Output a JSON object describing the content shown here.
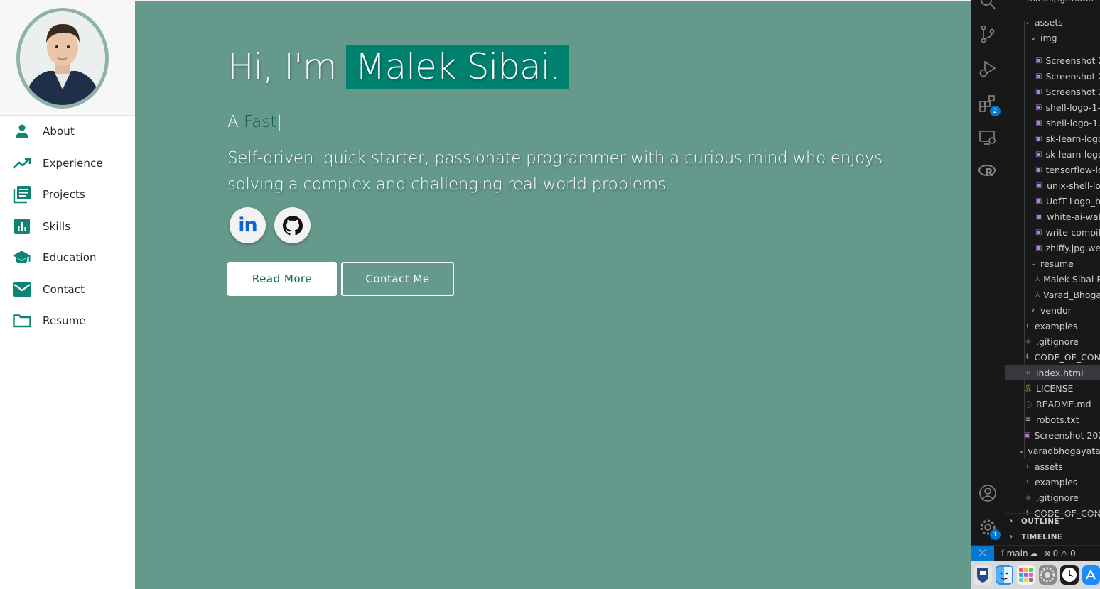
{
  "sidebar": {
    "items": [
      {
        "label": "About",
        "icon": "person-icon"
      },
      {
        "label": "Experience",
        "icon": "trending-up-icon"
      },
      {
        "label": "Projects",
        "icon": "library-books-icon"
      },
      {
        "label": "Skills",
        "icon": "bar-chart-icon"
      },
      {
        "label": "Education",
        "icon": "school-icon"
      },
      {
        "label": "Contact",
        "icon": "mail-icon"
      },
      {
        "label": "Resume",
        "icon": "folder-icon"
      }
    ]
  },
  "hero": {
    "greeting": "Hi, I'm",
    "name": "Malek Sibai.",
    "typing_prefix": "A",
    "typing_word": "Fast",
    "typing_cursor": "|",
    "description": "Self-driven, quick starter, passionate programmer with a curious mind who enjoys solving a complex and challenging real-world problems.",
    "read_more": "Read More",
    "contact_me": "Contact Me",
    "linkedin_text": "in"
  },
  "vscode": {
    "activity_badges": {
      "extensions": "2",
      "settings": "1"
    },
    "tree": [
      {
        "label": "assets",
        "kind": "folder-open"
      },
      {
        "label": "img",
        "kind": "folder-open"
      },
      {
        "label": "Screenshot 2",
        "kind": "image"
      },
      {
        "label": "Screenshot 2",
        "kind": "image"
      },
      {
        "label": "Screenshot 2",
        "kind": "image"
      },
      {
        "label": "shell-logo-1-",
        "kind": "image"
      },
      {
        "label": "shell-logo-1.",
        "kind": "image"
      },
      {
        "label": "sk-learn-logo",
        "kind": "image"
      },
      {
        "label": "sk-learn-logo",
        "kind": "image"
      },
      {
        "label": "tensorflow-lo",
        "kind": "image"
      },
      {
        "label": "unix-shell-lo",
        "kind": "image"
      },
      {
        "label": "UofT Logo_b",
        "kind": "image"
      },
      {
        "label": "white-ai-wal",
        "kind": "image"
      },
      {
        "label": "write-compil",
        "kind": "image"
      },
      {
        "label": "zhiffy.jpg.we",
        "kind": "image"
      },
      {
        "label": "resume",
        "kind": "folder-open"
      },
      {
        "label": "Malek Sibai R",
        "kind": "pdf"
      },
      {
        "label": "Varad_Bhoga",
        "kind": "pdf"
      },
      {
        "label": "vendor",
        "kind": "folder-closed"
      },
      {
        "label": "examples",
        "kind": "folder-closed"
      },
      {
        "label": ".gitignore",
        "kind": "git"
      },
      {
        "label": "CODE_OF_CON",
        "kind": "download"
      },
      {
        "label": "index.html",
        "kind": "html"
      },
      {
        "label": "LICENSE",
        "kind": "license"
      },
      {
        "label": "README.md",
        "kind": "info"
      },
      {
        "label": "robots.txt",
        "kind": "text"
      },
      {
        "label": "Screenshot 202",
        "kind": "image"
      },
      {
        "label": "varadbhogayata.",
        "kind": "folder-open"
      },
      {
        "label": "assets",
        "kind": "folder-closed"
      },
      {
        "label": "examples",
        "kind": "folder-closed"
      },
      {
        "label": ".gitignore",
        "kind": "git"
      },
      {
        "label": "CODE_OF_CON",
        "kind": "download"
      }
    ],
    "outline": "OUTLINE",
    "timeline": "TIMELINE",
    "status": {
      "branch": "main",
      "errors": "0",
      "warnings": "0"
    }
  },
  "colors": {
    "hero_bg": "#64998b",
    "accent": "#00806f",
    "accent_dark": "#0e6b5e"
  }
}
